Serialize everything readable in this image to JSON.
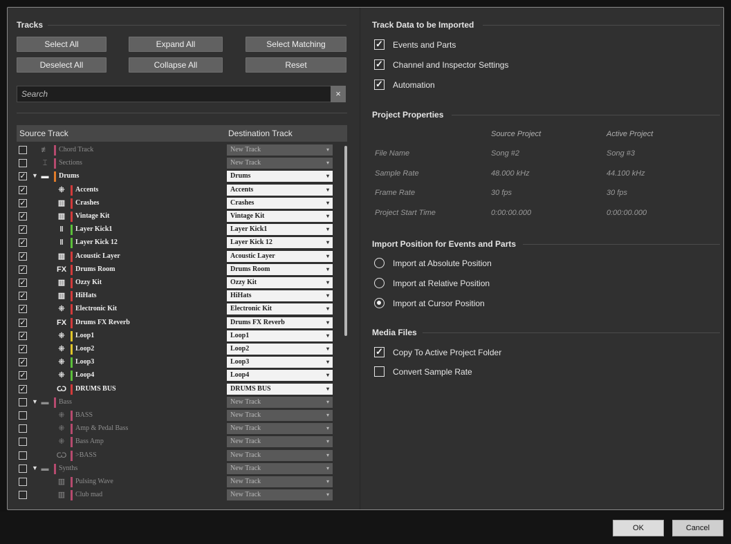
{
  "tracks_section": {
    "title": "Tracks",
    "buttons": {
      "select_all": "Select All",
      "expand_all": "Expand All",
      "select_matching": "Select Matching",
      "deselect_all": "Deselect All",
      "collapse_all": "Collapse All",
      "reset": "Reset"
    },
    "search_placeholder": "Search",
    "search_clear": "×",
    "columns": {
      "source": "Source Track",
      "destination": "Destination Track"
    },
    "rows": [
      {
        "checked": false,
        "folder": false,
        "icon": "chord-icon",
        "glyph": "≢",
        "name": "Chord Track",
        "dest": "New Track",
        "color": "#b64a6e",
        "indent": 1,
        "dim": true
      },
      {
        "checked": false,
        "folder": false,
        "icon": "marker-icon",
        "glyph": "⌶",
        "name": "Sections",
        "dest": "New Track",
        "color": "#b64a6e",
        "indent": 1,
        "dim": true
      },
      {
        "checked": true,
        "folder": true,
        "icon": "folder-icon",
        "glyph": "▬",
        "name": "Drums",
        "dest": "Drums",
        "color": "#e07b2a",
        "indent": 1,
        "dim": false
      },
      {
        "checked": true,
        "folder": false,
        "icon": "audio-wave-icon",
        "glyph": "⁜",
        "name": "Accents",
        "dest": "Accents",
        "color": "#d13b3b",
        "indent": 2,
        "dim": false
      },
      {
        "checked": true,
        "folder": false,
        "icon": "instrument-icon",
        "glyph": "▥",
        "name": "Crashes",
        "dest": "Crashes",
        "color": "#d13b3b",
        "indent": 2,
        "dim": false
      },
      {
        "checked": true,
        "folder": false,
        "icon": "instrument-icon",
        "glyph": "▥",
        "name": "Vintage Kit",
        "dest": "Vintage Kit",
        "color": "#d13b3b",
        "indent": 2,
        "dim": false
      },
      {
        "checked": true,
        "folder": false,
        "icon": "sampler-icon",
        "glyph": "‖",
        "name": "Layer Kick1",
        "dest": "Layer Kick1",
        "color": "#5cbf3a",
        "indent": 2,
        "dim": false
      },
      {
        "checked": true,
        "folder": false,
        "icon": "sampler-icon",
        "glyph": "‖",
        "name": "Layer Kick 12",
        "dest": "Layer Kick 12",
        "color": "#5cbf3a",
        "indent": 2,
        "dim": false
      },
      {
        "checked": true,
        "folder": false,
        "icon": "instrument-icon",
        "glyph": "▥",
        "name": "Acoustic Layer",
        "dest": "Acoustic Layer",
        "color": "#d13b3b",
        "indent": 2,
        "dim": false
      },
      {
        "checked": true,
        "folder": false,
        "icon": "fx-icon",
        "glyph": "FX",
        "name": "Drums Room",
        "dest": "Drums Room",
        "color": "#d13b3b",
        "indent": 2,
        "dim": false
      },
      {
        "checked": true,
        "folder": false,
        "icon": "instrument-icon",
        "glyph": "▥",
        "name": "Ozzy Kit",
        "dest": "Ozzy Kit",
        "color": "#d13b3b",
        "indent": 2,
        "dim": false
      },
      {
        "checked": true,
        "folder": false,
        "icon": "instrument-icon",
        "glyph": "▥",
        "name": "HiHats",
        "dest": "HiHats",
        "color": "#d13b3b",
        "indent": 2,
        "dim": false
      },
      {
        "checked": true,
        "folder": false,
        "icon": "audio-wave-icon",
        "glyph": "⁜",
        "name": "Electronic Kit",
        "dest": "Electronic Kit",
        "color": "#d13b3b",
        "indent": 2,
        "dim": false
      },
      {
        "checked": true,
        "folder": false,
        "icon": "fx-icon",
        "glyph": "FX",
        "name": "Drums FX Reverb",
        "dest": "Drums FX Reverb",
        "color": "#d13b3b",
        "indent": 2,
        "dim": false
      },
      {
        "checked": true,
        "folder": false,
        "icon": "audio-wave-icon",
        "glyph": "⁜",
        "name": "Loop1",
        "dest": "Loop1",
        "color": "#e0c52a",
        "indent": 2,
        "dim": false
      },
      {
        "checked": true,
        "folder": false,
        "icon": "audio-wave-icon",
        "glyph": "⁜",
        "name": "Loop2",
        "dest": "Loop2",
        "color": "#e0c52a",
        "indent": 2,
        "dim": false
      },
      {
        "checked": true,
        "folder": false,
        "icon": "audio-wave-icon",
        "glyph": "⁜",
        "name": "Loop3",
        "dest": "Loop3",
        "color": "#5cbf3a",
        "indent": 2,
        "dim": false
      },
      {
        "checked": true,
        "folder": false,
        "icon": "audio-wave-icon",
        "glyph": "⁜",
        "name": "Loop4",
        "dest": "Loop4",
        "color": "#5cbf3a",
        "indent": 2,
        "dim": false
      },
      {
        "checked": true,
        "folder": false,
        "icon": "group-bus-icon",
        "glyph": "Ѡ",
        "name": "DRUMS BUS",
        "dest": "DRUMS BUS",
        "color": "#d13b3b",
        "indent": 2,
        "dim": false
      },
      {
        "checked": false,
        "folder": true,
        "icon": "folder-icon",
        "glyph": "▬",
        "name": "Bass",
        "dest": "New Track",
        "color": "#b64a6e",
        "indent": 1,
        "dim": true
      },
      {
        "checked": false,
        "folder": false,
        "icon": "audio-wave-icon",
        "glyph": "⁜",
        "name": "BASS",
        "dest": "New Track",
        "color": "#b64a6e",
        "indent": 2,
        "dim": true
      },
      {
        "checked": false,
        "folder": false,
        "icon": "audio-wave-icon",
        "glyph": "⁜",
        "name": "Amp & Pedal Bass",
        "dest": "New Track",
        "color": "#b64a6e",
        "indent": 2,
        "dim": true
      },
      {
        "checked": false,
        "folder": false,
        "icon": "audio-wave-icon",
        "glyph": "⁜",
        "name": "Bass Amp",
        "dest": "New Track",
        "color": "#b64a6e",
        "indent": 2,
        "dim": true
      },
      {
        "checked": false,
        "folder": false,
        "icon": "group-bus-icon",
        "glyph": "Ѡ",
        "name": ">BASS",
        "dest": "New Track",
        "color": "#b64a6e",
        "indent": 2,
        "dim": true
      },
      {
        "checked": false,
        "folder": true,
        "icon": "folder-icon",
        "glyph": "▬",
        "name": "Synths",
        "dest": "New Track",
        "color": "#b64a6e",
        "indent": 1,
        "dim": true
      },
      {
        "checked": false,
        "folder": false,
        "icon": "instrument-icon",
        "glyph": "▥",
        "name": "Pulsing Wave",
        "dest": "New Track",
        "color": "#b64a6e",
        "indent": 2,
        "dim": true
      },
      {
        "checked": false,
        "folder": false,
        "icon": "instrument-icon",
        "glyph": "▥",
        "name": "Club mad",
        "dest": "New Track",
        "color": "#b64a6e",
        "indent": 2,
        "dim": true
      }
    ]
  },
  "import_data": {
    "title": "Track Data to be Imported",
    "options": [
      {
        "label": "Events and Parts",
        "checked": true
      },
      {
        "label": "Channel and Inspector Settings",
        "checked": true
      },
      {
        "label": "Automation",
        "checked": true
      }
    ]
  },
  "project_properties": {
    "title": "Project Properties",
    "col_source": "Source Project",
    "col_active": "Active Project",
    "rows": [
      {
        "label": "File Name",
        "source": "Song #2",
        "active": "Song #3"
      },
      {
        "label": "Sample Rate",
        "source": "48.000 kHz",
        "active": "44.100 kHz"
      },
      {
        "label": "Frame Rate",
        "source": "30 fps",
        "active": "30 fps"
      },
      {
        "label": "Project Start Time",
        "source": "0:00:00.000",
        "active": "0:00:00.000"
      }
    ]
  },
  "import_position": {
    "title": "Import Position for Events and Parts",
    "options": [
      {
        "label": "Import at Absolute Position",
        "selected": false
      },
      {
        "label": "Import at Relative Position",
        "selected": false
      },
      {
        "label": "Import at Cursor Position",
        "selected": true
      }
    ]
  },
  "media_files": {
    "title": "Media Files",
    "options": [
      {
        "label": "Copy To Active Project Folder",
        "checked": true
      },
      {
        "label": "Convert Sample Rate",
        "checked": false
      }
    ]
  },
  "footer": {
    "ok": "OK",
    "cancel": "Cancel"
  }
}
